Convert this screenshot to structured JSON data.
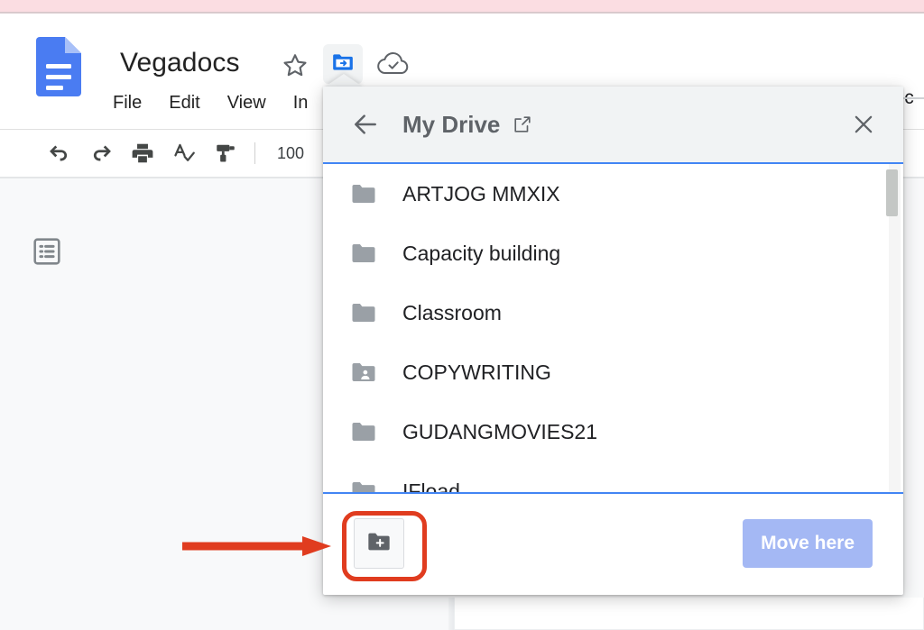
{
  "app": {
    "doc_title": "Vegadocs",
    "logo_icon": "google-docs-logo",
    "star_icon": "star-outline-icon",
    "move_to_folder_icon": "move-to-folder-icon",
    "cloud_saved_icon": "cloud-check-icon",
    "share_partial_label": "Sc"
  },
  "menubar": {
    "items": [
      {
        "label": "File"
      },
      {
        "label": "Edit"
      },
      {
        "label": "View"
      },
      {
        "label": "In"
      }
    ]
  },
  "toolbar": {
    "buttons": [
      {
        "name": "undo-button",
        "icon": "undo-icon"
      },
      {
        "name": "redo-button",
        "icon": "redo-icon"
      },
      {
        "name": "print-button",
        "icon": "print-icon"
      },
      {
        "name": "spelling-button",
        "icon": "spellcheck-icon"
      },
      {
        "name": "paint-format-button",
        "icon": "paint-roller-icon"
      }
    ],
    "zoom_value": "100"
  },
  "canvas": {
    "outline_icon": "document-outline-icon"
  },
  "dialog": {
    "back_icon": "back-arrow-icon",
    "title": "My Drive",
    "open_new_tab_icon": "open-in-new-icon",
    "close_icon": "close-x-icon",
    "folders": [
      {
        "label": "ARTJOG MMXIX",
        "icon": "folder-icon",
        "shared": false
      },
      {
        "label": "Capacity building",
        "icon": "folder-icon",
        "shared": false
      },
      {
        "label": "Classroom",
        "icon": "folder-icon",
        "shared": false
      },
      {
        "label": "COPYWRITING",
        "icon": "folder-shared-icon",
        "shared": true
      },
      {
        "label": "GUDANGMOVIES21",
        "icon": "folder-icon",
        "shared": false
      },
      {
        "label": "IFload",
        "icon": "folder-icon",
        "shared": false
      }
    ],
    "footer": {
      "new_folder_icon": "new-folder-icon",
      "move_here_label": "Move here"
    }
  },
  "annotations": {
    "highlight_color": "#e03c1f",
    "arrow_icon": "red-arrow-right",
    "ring_target": "new-folder-button"
  },
  "colors": {
    "accent_blue": "#4285f4",
    "move_here_bg": "#a4b8f4",
    "pink_band": "#fbdde2",
    "dialog_header_bg": "#f1f3f4"
  }
}
